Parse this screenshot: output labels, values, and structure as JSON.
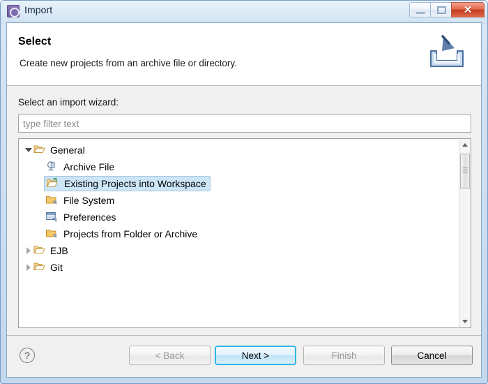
{
  "window": {
    "title": "Import",
    "icon": "eclipse-wizard-icon",
    "controls": {
      "minimize": "minimize-icon",
      "maximize": "maximize-icon",
      "close": "✕"
    }
  },
  "header": {
    "title": "Select",
    "subtitle": "Create new projects from an archive file or directory.",
    "banner_icon": "import-tray-icon"
  },
  "content": {
    "field_label": "Select an import wizard:",
    "filter": {
      "value": "",
      "placeholder": "type filter text"
    },
    "tree": [
      {
        "label": "General",
        "level": 0,
        "state": "expanded",
        "icon": "open-folder-icon",
        "selected": false
      },
      {
        "label": "Archive File",
        "level": 1,
        "state": "leaf",
        "icon": "archive-file-icon",
        "selected": false
      },
      {
        "label": "Existing Projects into Workspace",
        "level": 1,
        "state": "leaf",
        "icon": "project-import-icon",
        "selected": true
      },
      {
        "label": "File System",
        "level": 1,
        "state": "leaf",
        "icon": "folder-icon",
        "selected": false
      },
      {
        "label": "Preferences",
        "level": 1,
        "state": "leaf",
        "icon": "preferences-icon",
        "selected": false
      },
      {
        "label": "Projects from Folder or Archive",
        "level": 1,
        "state": "leaf",
        "icon": "folder-icon",
        "selected": false
      },
      {
        "label": "EJB",
        "level": 0,
        "state": "collapsed",
        "icon": "open-folder-icon",
        "selected": false
      },
      {
        "label": "Git",
        "level": 0,
        "state": "collapsed",
        "icon": "open-folder-icon",
        "selected": false
      }
    ]
  },
  "footer": {
    "help": "?",
    "buttons": [
      {
        "label": "< Back",
        "enabled": false,
        "focused": false
      },
      {
        "label": "Next >",
        "enabled": true,
        "focused": true
      },
      {
        "label": "Finish",
        "enabled": false,
        "focused": false
      },
      {
        "label": "Cancel",
        "enabled": true,
        "focused": false
      }
    ]
  },
  "colors": {
    "selection": "#cde6f7",
    "focus_border": "#2fb6e8",
    "close_button": "#c33a20",
    "folder": "#f0c061",
    "title_bar": "#dbe9f7"
  }
}
